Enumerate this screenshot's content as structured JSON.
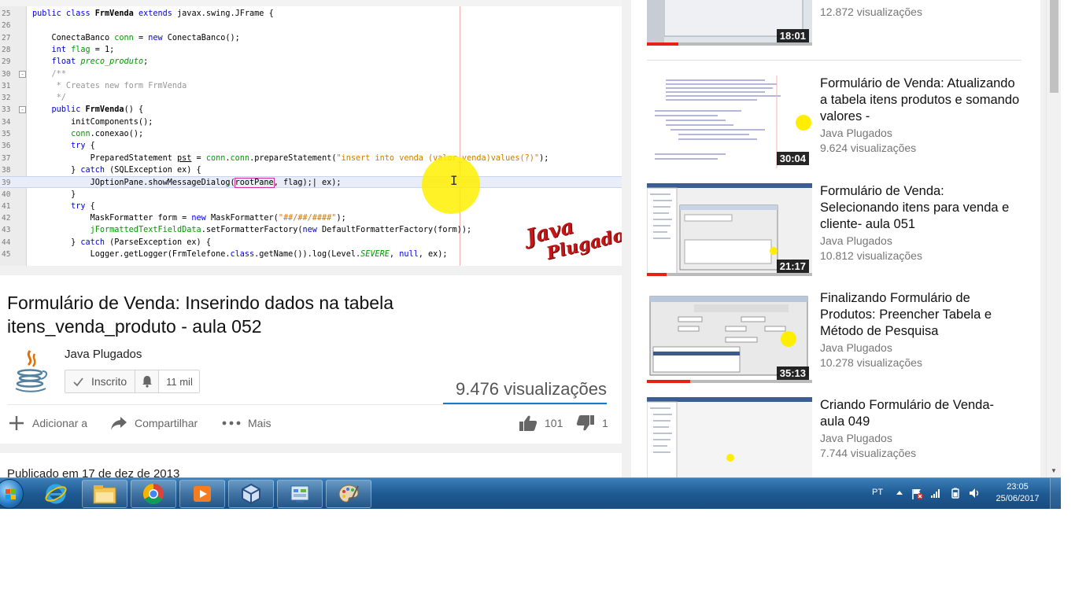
{
  "video": {
    "code_lines": [
      {
        "n": "25",
        "html": "<span class=\"kw\">public class</span> <b>FrmVenda</b> <span class=\"kw\">extends</span> javax.swing.JFrame {"
      },
      {
        "n": "26",
        "html": ""
      },
      {
        "n": "27",
        "html": "    ConectaBanco <span class=\"fld\">conn</span> = <span class=\"kw\">new</span> ConectaBanco();"
      },
      {
        "n": "28",
        "html": "    <span class=\"kw\">int</span> <span class=\"fld\">flag</span> = 1;"
      },
      {
        "n": "29",
        "html": "    <span class=\"kw\">float</span> <span class=\"fld ital\">preco_produto</span>;"
      },
      {
        "n": "30",
        "html": "    <span class=\"cm\">/**</span>",
        "fold": "-"
      },
      {
        "n": "31",
        "html": "<span class=\"cm\">     * Creates new form FrmVenda</span>"
      },
      {
        "n": "32",
        "html": "<span class=\"cm\">     */</span>"
      },
      {
        "n": "33",
        "html": "    <span class=\"kw\">public</span> <b>FrmVenda</b>() {",
        "fold": "-"
      },
      {
        "n": "34",
        "html": "        initComponents();"
      },
      {
        "n": "35",
        "html": "        <span class=\"fld\">conn</span>.conexao();"
      },
      {
        "n": "36",
        "html": "        <span class=\"kw\">try</span> {"
      },
      {
        "n": "37",
        "html": "            PreparedStatement <u>pst</u> = <span class=\"fld\">conn</span>.<span class=\"fld\">conn</span>.prepareStatement(<span class=\"str\">\"insert into venda (valor_venda)values(?)\"</span>);"
      },
      {
        "n": "38",
        "html": "        } <span class=\"kw\">catch</span> (SQLException ex) {"
      },
      {
        "n": "39",
        "html": "            JOptionPane.showMessageDialog(<span class=\"boxed\">rootPane</span>, flag);| ex);",
        "hl": true
      },
      {
        "n": "40",
        "html": "        }"
      },
      {
        "n": "41",
        "html": "        <span class=\"kw\">try</span> {"
      },
      {
        "n": "42",
        "html": "            MaskFormatter form = <span class=\"kw\">new</span> MaskFormatter(<span class=\"str\">\"##/##/####\"</span>);"
      },
      {
        "n": "43",
        "html": "            <span class=\"fld\">jFormattedTextFieldData</span>.setFormatterFactory(<span class=\"kw\">new</span> DefaultFormatterFactory(form));"
      },
      {
        "n": "44",
        "html": "        } <span class=\"kw\">catch</span> (ParseException ex) {"
      },
      {
        "n": "45",
        "html": "            Logger.getLogger(FrmTelefone.<span class=\"kw\">class</span>.getName()).log(Level.<span class=\"fld ital\">SEVERE</span>, <span class=\"kw\">null</span>, ex);"
      }
    ],
    "watermark_line1": "Java",
    "watermark_line2": "Plugados"
  },
  "info": {
    "title": "Formulário de Venda: Inserindo dados na tabela itens_venda_produto - aula 052",
    "channel": "Java Plugados",
    "subscribe_label": "Inscrito",
    "subscriber_count": "11 mil",
    "views": "9.476 visualizações",
    "actions": {
      "add_to": "Adicionar a",
      "share": "Compartilhar",
      "more": "Mais",
      "likes": "101",
      "dislikes": "1"
    },
    "published": "Publicado em 17 de dez de 2013"
  },
  "sidebar": {
    "top_partial": {
      "views": "12.872 visualizações",
      "duration": "18:01",
      "watched": 0.19
    },
    "items": [
      {
        "title": "Formulário de Venda: Atualizando a tabela itens produtos e somando valores -",
        "channel": "Java Plugados",
        "views": "9.624 visualizações",
        "duration": "30:04",
        "watched": 0
      },
      {
        "title": "Formulário de Venda: Selecionando itens para venda e cliente- aula 051",
        "channel": "Java Plugados",
        "views": "10.812 visualizações",
        "duration": "21:17",
        "watched": 0.12
      },
      {
        "title": "Finalizando Formulário de Produtos: Preencher Tabela e Método de Pesquisa",
        "channel": "Java Plugados",
        "views": "10.278 visualizações",
        "duration": "35:13",
        "watched": 0.26
      },
      {
        "title": "Criando Formulário de Venda- aula 049",
        "channel": "Java Plugados",
        "views": "7.744 visualizações",
        "duration": "",
        "watched": 0
      }
    ]
  },
  "taskbar": {
    "language": "PT",
    "time": "23:05",
    "date": "25/06/2017"
  },
  "colors": {
    "accent_blue": "#167ac6",
    "progress_red": "#e62117",
    "taskbar_blue": "#1f5a93"
  }
}
